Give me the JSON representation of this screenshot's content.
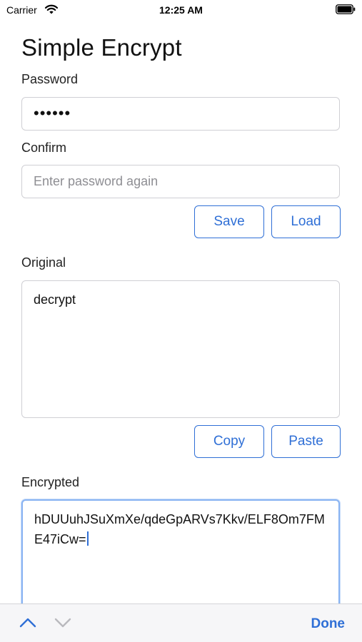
{
  "status_bar": {
    "carrier": "Carrier",
    "time": "12:25 AM"
  },
  "app": {
    "title": "Simple Encrypt"
  },
  "password": {
    "label": "Password",
    "value": "••••••"
  },
  "confirm": {
    "label": "Confirm",
    "placeholder": "Enter password again"
  },
  "buttons": {
    "save": "Save",
    "load": "Load",
    "copy": "Copy",
    "paste": "Paste"
  },
  "original": {
    "label": "Original",
    "value": "decrypt"
  },
  "encrypted": {
    "label": "Encrypted",
    "value": "hDUUuhJSuXmXe/qdeGpARVs7Kkv/ELF8Om7FME47iCw="
  },
  "keyboard_accessory": {
    "done": "Done"
  },
  "colors": {
    "accent": "#2f6fd6",
    "border": "#cfcfd4",
    "placeholder": "#8e8e93",
    "focus_border": "#8ab4f2"
  }
}
